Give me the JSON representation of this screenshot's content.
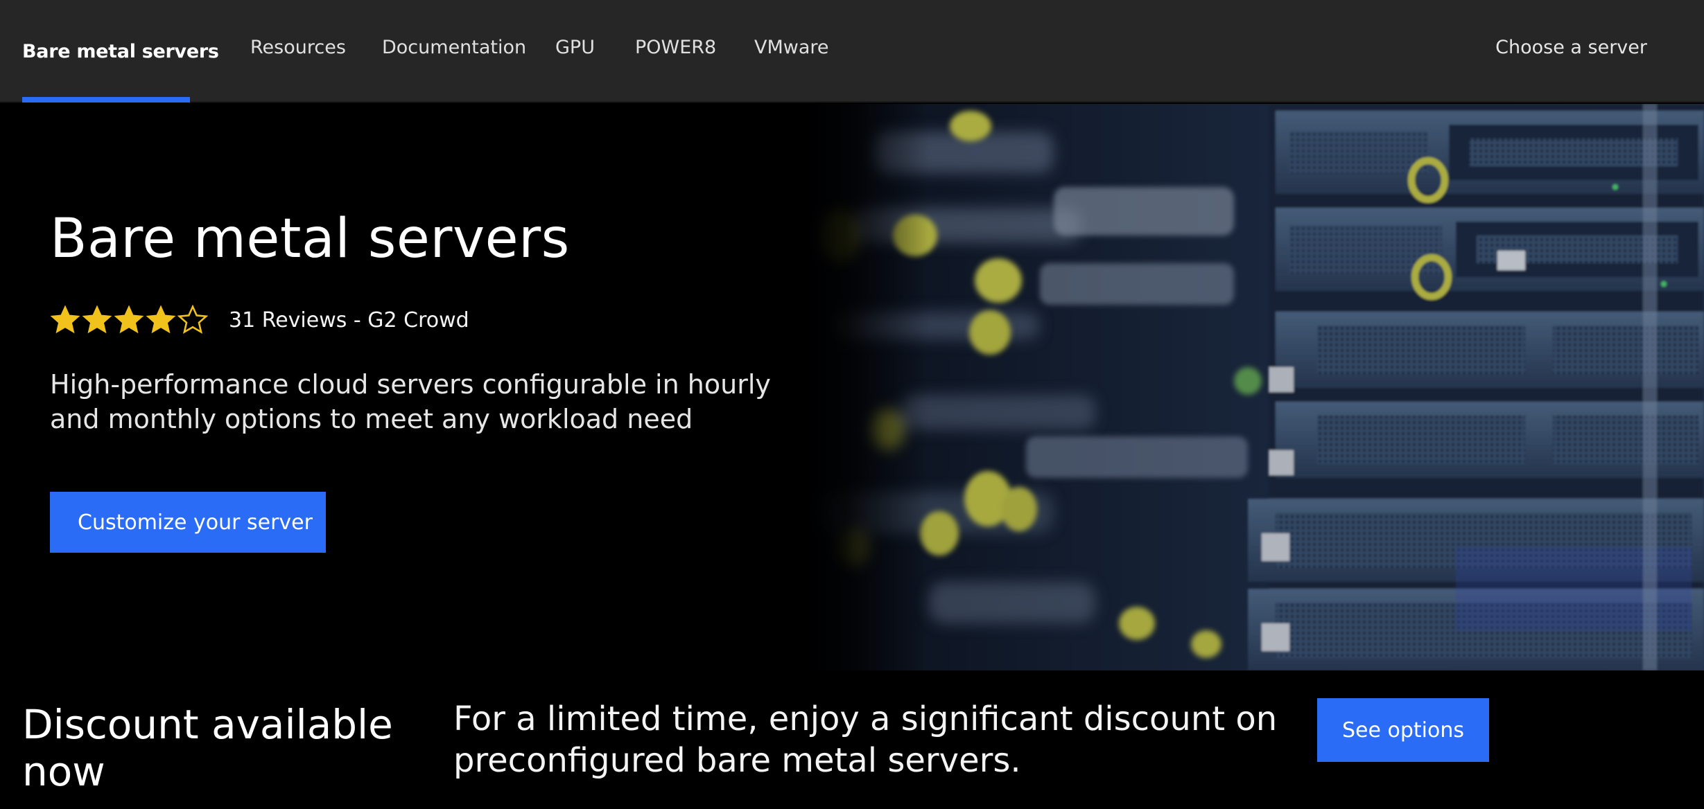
{
  "nav": {
    "brand": "Bare metal servers",
    "items": [
      {
        "label": "Resources"
      },
      {
        "label": "Documentation"
      },
      {
        "label": "GPU"
      },
      {
        "label": "POWER8"
      },
      {
        "label": "VMware"
      }
    ],
    "cta": "Choose a server"
  },
  "hero": {
    "title": "Bare metal servers",
    "rating": {
      "value": 4,
      "max": 5,
      "text": "31 Reviews - G2 Crowd"
    },
    "description": "High-performance cloud servers configurable in hourly and monthly options to meet any workload need",
    "button": "Customize your server"
  },
  "discount": {
    "title": "Discount available now",
    "text": "For a limited time, enjoy a significant discount on preconfigured bare metal servers.",
    "button": "See options"
  },
  "colors": {
    "accent": "#2b6cf6",
    "nav_bg": "#262626",
    "star": "#f1c21b"
  }
}
